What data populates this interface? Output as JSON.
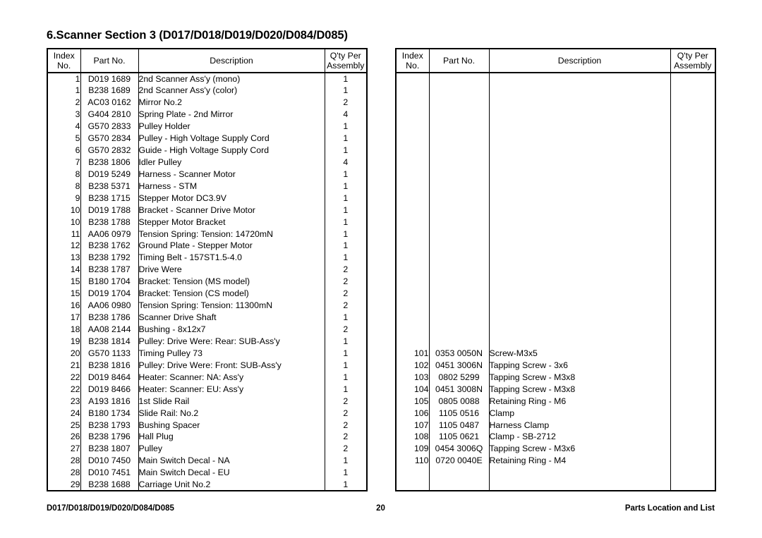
{
  "title": "6.Scanner Section 3 (D017/D018/D019/D020/D084/D085)",
  "table_headers": {
    "index_line1": "Index",
    "index_line2": "No.",
    "part_no": "Part No.",
    "description": "Description",
    "qty_line1": "Q'ty Per",
    "qty_line2": "Assembly"
  },
  "left_table": {
    "rows": [
      {
        "index": "1",
        "part_no": "D019 1689",
        "description": "2nd Scanner Ass'y (mono)",
        "qty": "1"
      },
      {
        "index": "1",
        "part_no": "B238 1689",
        "description": "2nd Scanner Ass'y (color)",
        "qty": "1"
      },
      {
        "index": "2",
        "part_no": "AC03 0162",
        "description": "Mirror No.2",
        "qty": "2"
      },
      {
        "index": "3",
        "part_no": "G404 2810",
        "description": "Spring Plate - 2nd Mirror",
        "qty": "4"
      },
      {
        "index": "4",
        "part_no": "G570 2833",
        "description": "Pulley Holder",
        "qty": "1"
      },
      {
        "index": "5",
        "part_no": "G570 2834",
        "description": "Pulley - High Voltage Supply Cord",
        "qty": "1"
      },
      {
        "index": "6",
        "part_no": "G570 2832",
        "description": "Guide - High Voltage Supply Cord",
        "qty": "1"
      },
      {
        "index": "7",
        "part_no": "B238 1806",
        "description": "Idler Pulley",
        "qty": "4"
      },
      {
        "index": "8",
        "part_no": "D019 5249",
        "description": "Harness - Scanner Motor",
        "qty": "1"
      },
      {
        "index": "8",
        "part_no": "B238 5371",
        "description": "Harness - STM",
        "qty": "1"
      },
      {
        "index": "9",
        "part_no": "B238 1715",
        "description": "Stepper Motor DC3.9V",
        "qty": "1"
      },
      {
        "index": "10",
        "part_no": "D019 1788",
        "description": "Bracket - Scanner Drive Motor",
        "qty": "1"
      },
      {
        "index": "10",
        "part_no": "B238 1788",
        "description": "Stepper Motor Bracket",
        "qty": "1"
      },
      {
        "index": "11",
        "part_no": "AA06 0979",
        "description": "Tension Spring: Tension: 14720mN",
        "qty": "1"
      },
      {
        "index": "12",
        "part_no": "B238 1762",
        "description": "Ground Plate - Stepper Motor",
        "qty": "1"
      },
      {
        "index": "13",
        "part_no": "B238 1792",
        "description": "Timing Belt - 157ST1.5-4.0",
        "qty": "1"
      },
      {
        "index": "14",
        "part_no": "B238 1787",
        "description": "Drive Were",
        "qty": "2"
      },
      {
        "index": "15",
        "part_no": "B180 1704",
        "description": "Bracket: Tension (MS model)",
        "qty": "2"
      },
      {
        "index": "15",
        "part_no": "D019 1704",
        "description": "Bracket: Tension (CS model)",
        "qty": "2"
      },
      {
        "index": "16",
        "part_no": "AA06 0980",
        "description": "Tension Spring: Tension: 11300mN",
        "qty": "2"
      },
      {
        "index": "17",
        "part_no": "B238 1786",
        "description": "Scanner Drive Shaft",
        "qty": "1"
      },
      {
        "index": "18",
        "part_no": "AA08 2144",
        "description": "Bushing - 8x12x7",
        "qty": "2"
      },
      {
        "index": "19",
        "part_no": "B238 1814",
        "description": "Pulley: Drive Were: Rear: SUB-Ass'y",
        "qty": "1"
      },
      {
        "index": "20",
        "part_no": "G570 1133",
        "description": "Timing Pulley 73",
        "qty": "1"
      },
      {
        "index": "21",
        "part_no": "B238 1816",
        "description": "Pulley: Drive Were: Front: SUB-Ass'y",
        "qty": "1"
      },
      {
        "index": "22",
        "part_no": "D019 8464",
        "description": "Heater: Scanner: NA: Ass'y",
        "qty": "1"
      },
      {
        "index": "22",
        "part_no": "D019 8466",
        "description": "Heater: Scanner: EU: Ass'y",
        "qty": "1"
      },
      {
        "index": "23",
        "part_no": "A193 1816",
        "description": "1st Slide Rail",
        "qty": "2"
      },
      {
        "index": "24",
        "part_no": "B180 1734",
        "description": "Slide Rail: No.2",
        "qty": "2"
      },
      {
        "index": "25",
        "part_no": "B238 1793",
        "description": "Bushing Spacer",
        "qty": "2"
      },
      {
        "index": "26",
        "part_no": "B238 1796",
        "description": "Hall Plug",
        "qty": "2"
      },
      {
        "index": "27",
        "part_no": "B238 1807",
        "description": "Pulley",
        "qty": "2"
      },
      {
        "index": "28",
        "part_no": "D010 7450",
        "description": "Main Switch Decal - NA",
        "qty": "1"
      },
      {
        "index": "28",
        "part_no": "D010 7451",
        "description": "Main Switch Decal - EU",
        "qty": "1"
      },
      {
        "index": "29",
        "part_no": "B238 1688",
        "description": "Carriage Unit No.2",
        "qty": "1"
      }
    ]
  },
  "right_table": {
    "leading_blank_rows": 23,
    "trailing_blank_rows": 2,
    "rows": [
      {
        "index": "101",
        "part_no": "0353 0050N",
        "description": "Screw-M3x5",
        "qty": ""
      },
      {
        "index": "102",
        "part_no": "0451 3006N",
        "description": "Tapping Screw - 3x6",
        "qty": ""
      },
      {
        "index": "103",
        "part_no": "0802 5299",
        "description": "Tapping Screw - M3x8",
        "qty": ""
      },
      {
        "index": "104",
        "part_no": "0451 3008N",
        "description": "Tapping Screw - M3x8",
        "qty": ""
      },
      {
        "index": "105",
        "part_no": "0805 0088",
        "description": "Retaining Ring - M6",
        "qty": ""
      },
      {
        "index": "106",
        "part_no": "1105 0516",
        "description": "Clamp",
        "qty": ""
      },
      {
        "index": "107",
        "part_no": "1105 0487",
        "description": "Harness Clamp",
        "qty": ""
      },
      {
        "index": "108",
        "part_no": "1105 0621",
        "description": "Clamp - SB-2712",
        "qty": ""
      },
      {
        "index": "109",
        "part_no": "0454 3006Q",
        "description": "Tapping Screw - M3x6",
        "qty": ""
      },
      {
        "index": "110",
        "part_no": "0720 0040E",
        "description": "Retaining Ring - M4",
        "qty": ""
      }
    ]
  },
  "footer": {
    "left": "D017/D018/D019/D020/D084/D085",
    "page_number": "20",
    "right": "Parts Location and List"
  }
}
